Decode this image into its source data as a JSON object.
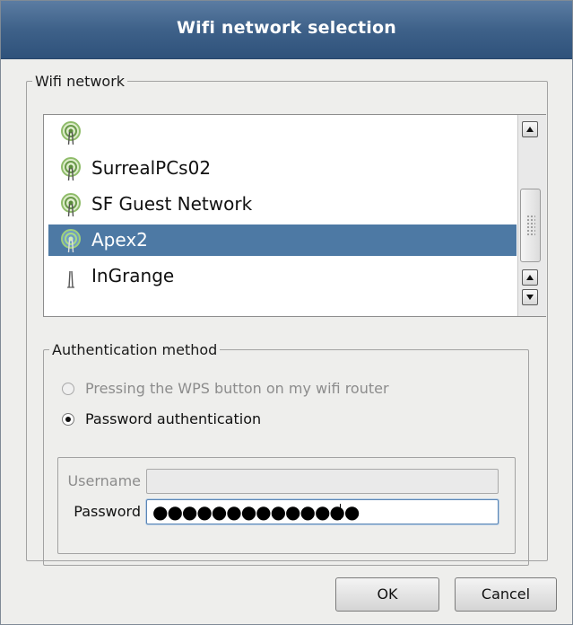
{
  "window": {
    "title": "Wifi network selection"
  },
  "wifi_group": {
    "legend": "Wifi network",
    "networks": [
      {
        "name": "",
        "signal_icon": "wifi-signal-icon",
        "selected": false
      },
      {
        "name": "SurrealPCs02",
        "signal_icon": "wifi-signal-icon",
        "selected": false
      },
      {
        "name": "SF Guest Network",
        "signal_icon": "wifi-signal-icon",
        "selected": false
      },
      {
        "name": "Apex2",
        "signal_icon": "wifi-signal-icon",
        "selected": true
      },
      {
        "name": "InGrange",
        "signal_icon": "antenna-icon",
        "selected": false
      }
    ]
  },
  "auth_group": {
    "legend": "Authentication method",
    "options": [
      {
        "label": "Pressing the WPS button on my wifi router",
        "checked": false,
        "enabled": false
      },
      {
        "label": "Password authentication",
        "checked": true,
        "enabled": true
      }
    ]
  },
  "credentials": {
    "username_label": "Username",
    "username_value": "",
    "password_label": "Password",
    "password_value": "●●●●●●●●●●●●●●"
  },
  "buttons": {
    "ok": "OK",
    "cancel": "Cancel"
  },
  "colors": {
    "titlebar": "#3e6189",
    "selection": "#4d79a4",
    "wifi_icon": "#6a9a4a"
  }
}
